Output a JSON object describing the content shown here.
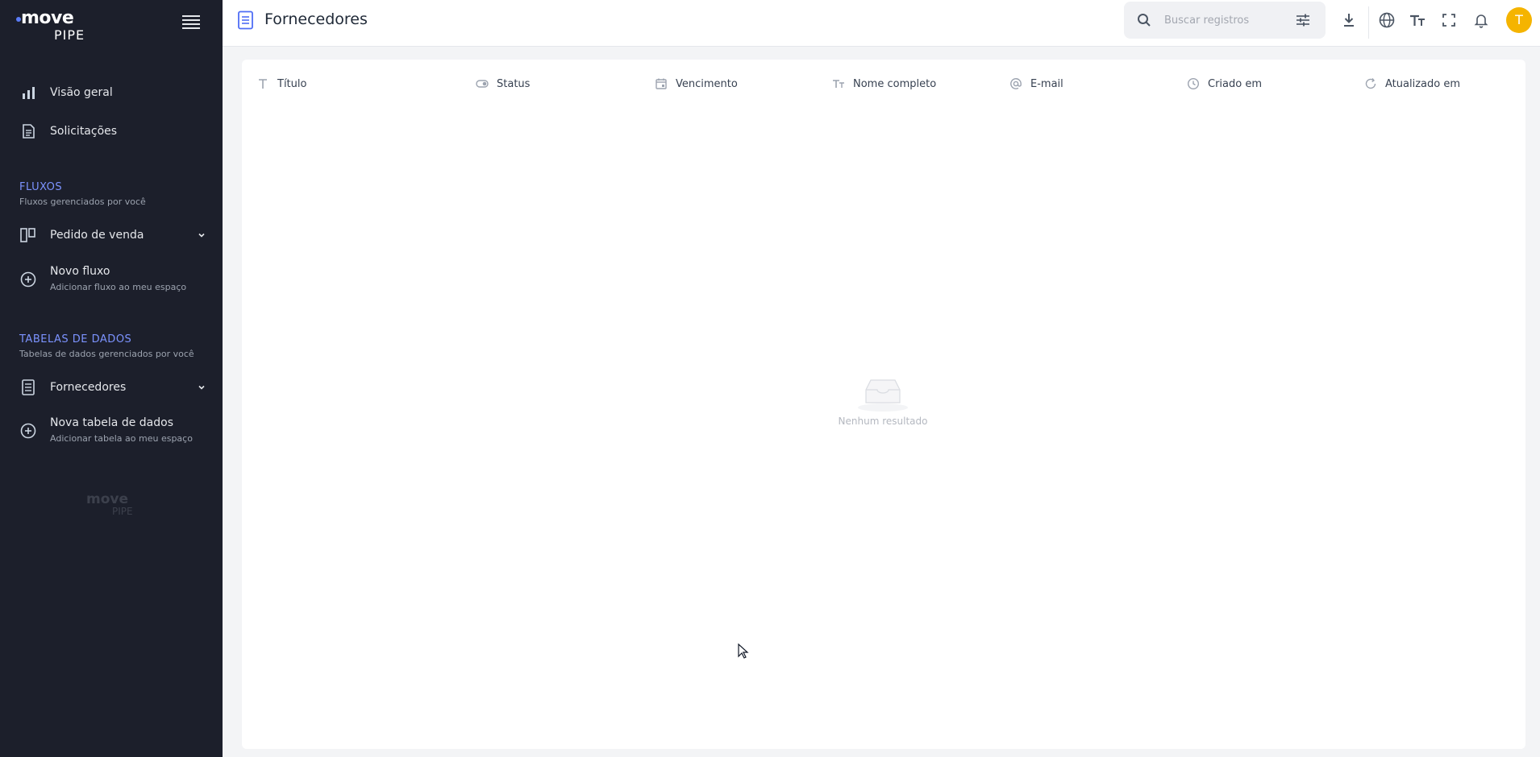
{
  "brand": {
    "line1": "move",
    "line2": "PIPE"
  },
  "sidebar": {
    "nav": [
      {
        "label": "Visão geral",
        "icon": "bar-chart-icon"
      },
      {
        "label": "Solicitações",
        "icon": "document-icon"
      }
    ],
    "flows": {
      "title": "FLUXOS",
      "subtitle": "Fluxos gerenciados por você",
      "items": [
        {
          "label": "Pedido de venda",
          "icon": "kanban-icon"
        }
      ],
      "add": {
        "label": "Novo fluxo",
        "sub": "Adicionar fluxo ao meu espaço"
      }
    },
    "tables": {
      "title": "TABELAS DE DADOS",
      "subtitle": "Tabelas de dados gerenciados por você",
      "items": [
        {
          "label": "Fornecedores",
          "icon": "list-document-icon"
        }
      ],
      "add": {
        "label": "Nova tabela de dados",
        "sub": "Adicionar tabela ao meu espaço"
      }
    },
    "footer_brand": {
      "line1": "move",
      "line2": "PIPE"
    }
  },
  "header": {
    "title": "Fornecedores",
    "search_placeholder": "Buscar registros",
    "avatar_initial": "T"
  },
  "table": {
    "columns": [
      {
        "label": "Título",
        "icon": "text-icon"
      },
      {
        "label": "Status",
        "icon": "toggle-icon"
      },
      {
        "label": "Vencimento",
        "icon": "calendar-icon"
      },
      {
        "label": "Nome completo",
        "icon": "text-size-icon"
      },
      {
        "label": "E-mail",
        "icon": "at-icon"
      },
      {
        "label": "Criado em",
        "icon": "clock-icon"
      },
      {
        "label": "Atualizado em",
        "icon": "refresh-icon"
      }
    ],
    "rows": [],
    "empty_text": "Nenhum resultado"
  },
  "colors": {
    "sidebar_bg": "#1c1f2b",
    "accent": "#7c93ff",
    "avatar": "#f5b400"
  }
}
